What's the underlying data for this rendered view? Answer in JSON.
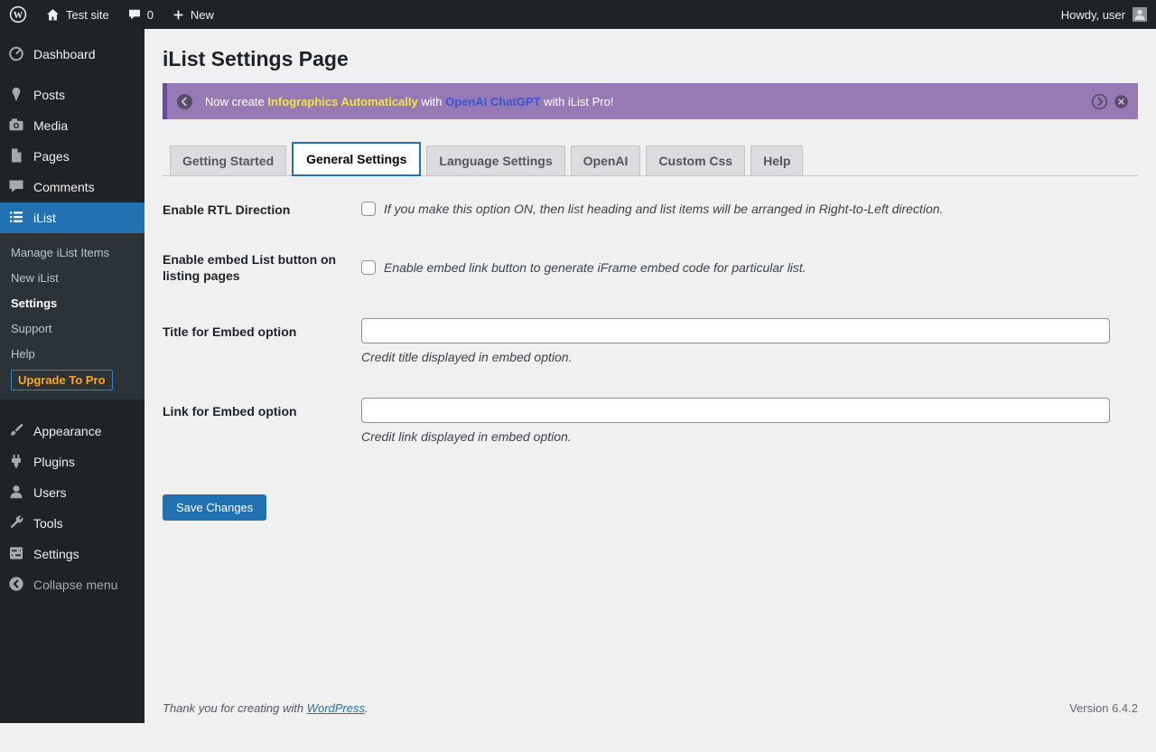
{
  "admin_bar": {
    "site_name": "Test site",
    "comments_count": "0",
    "new_label": "New",
    "howdy": "Howdy, user"
  },
  "sidebar": {
    "items": [
      {
        "label": "Dashboard"
      },
      {
        "label": "Posts"
      },
      {
        "label": "Media"
      },
      {
        "label": "Pages"
      },
      {
        "label": "Comments"
      },
      {
        "label": "iList",
        "active": true
      },
      {
        "label": "Appearance"
      },
      {
        "label": "Plugins"
      },
      {
        "label": "Users"
      },
      {
        "label": "Tools"
      },
      {
        "label": "Settings"
      },
      {
        "label": "Collapse menu"
      }
    ],
    "ilist_submenu": [
      {
        "label": "Manage iList Items"
      },
      {
        "label": "New iList"
      },
      {
        "label": "Settings",
        "active": true
      },
      {
        "label": "Support"
      },
      {
        "label": "Help"
      },
      {
        "label": "Upgrade To Pro",
        "style": "upgrade"
      }
    ]
  },
  "main": {
    "page_title": "iList Settings Page",
    "banner": {
      "part1": "Now create ",
      "highlight": "Infographics Automatically",
      "part2": " with ",
      "link": "OpenAI ChatGPT",
      "part3": " with iList Pro!"
    },
    "tabs": [
      {
        "label": "Getting Started"
      },
      {
        "label": "General Settings",
        "active": true
      },
      {
        "label": "Language Settings"
      },
      {
        "label": "OpenAI"
      },
      {
        "label": "Custom Css"
      },
      {
        "label": "Help"
      }
    ],
    "form": {
      "rows": [
        {
          "label": "Enable RTL Direction",
          "type": "checkbox",
          "checked": false,
          "desc": "If you make this option ON, then list heading and list items will be arranged in Right-to-Left direction."
        },
        {
          "label": "Enable embed List button on listing pages",
          "type": "checkbox",
          "checked": false,
          "desc": "Enable embed link button to generate iFrame embed code for particular list."
        },
        {
          "label": "Title for Embed option",
          "type": "text",
          "value": "",
          "desc": "Credit title displayed in embed option."
        },
        {
          "label": "Link for Embed option",
          "type": "text",
          "value": "",
          "desc": "Credit link displayed in embed option."
        }
      ]
    },
    "save_label": "Save Changes"
  },
  "footer": {
    "thanks_prefix": "Thank you for creating with ",
    "wordpress_link": "WordPress",
    "thanks_suffix": ".",
    "version": "Version 6.4.2"
  },
  "icons": {
    "wordpress-logo-icon": "W in circle",
    "home-icon": "house",
    "comments-bubble-icon": "speech bubble",
    "plus-icon": "plus",
    "avatar": "person silhouette",
    "dashboard-icon": "speedometer",
    "posts-icon": "pin",
    "media-icon": "camera",
    "pages-icon": "document",
    "comments-icon": "speech bubble",
    "ilist-icon": "bulleted list",
    "appearance-icon": "paintbrush",
    "plugins-icon": "plug",
    "users-icon": "person",
    "tools-icon": "wrench",
    "settings-icon": "control panel",
    "collapse-icon": "circled left arrow",
    "banner-prev-icon": "circled chevron left",
    "banner-next-icon": "circled chevron right",
    "banner-close-icon": "circled x"
  },
  "colors": {
    "accent": "#2271b1",
    "admin_bar_bg": "#1d2327",
    "sidebar_bg": "#1d2327",
    "submenu_bg": "#2c3338",
    "content_bg": "#f0f0f1",
    "banner_bg": "#9679b5",
    "banner_accent": "#6a4b99",
    "banner_highlight": "#f3e24b",
    "banner_link": "#3b55d3",
    "upgrade_text": "#ffa41c"
  }
}
